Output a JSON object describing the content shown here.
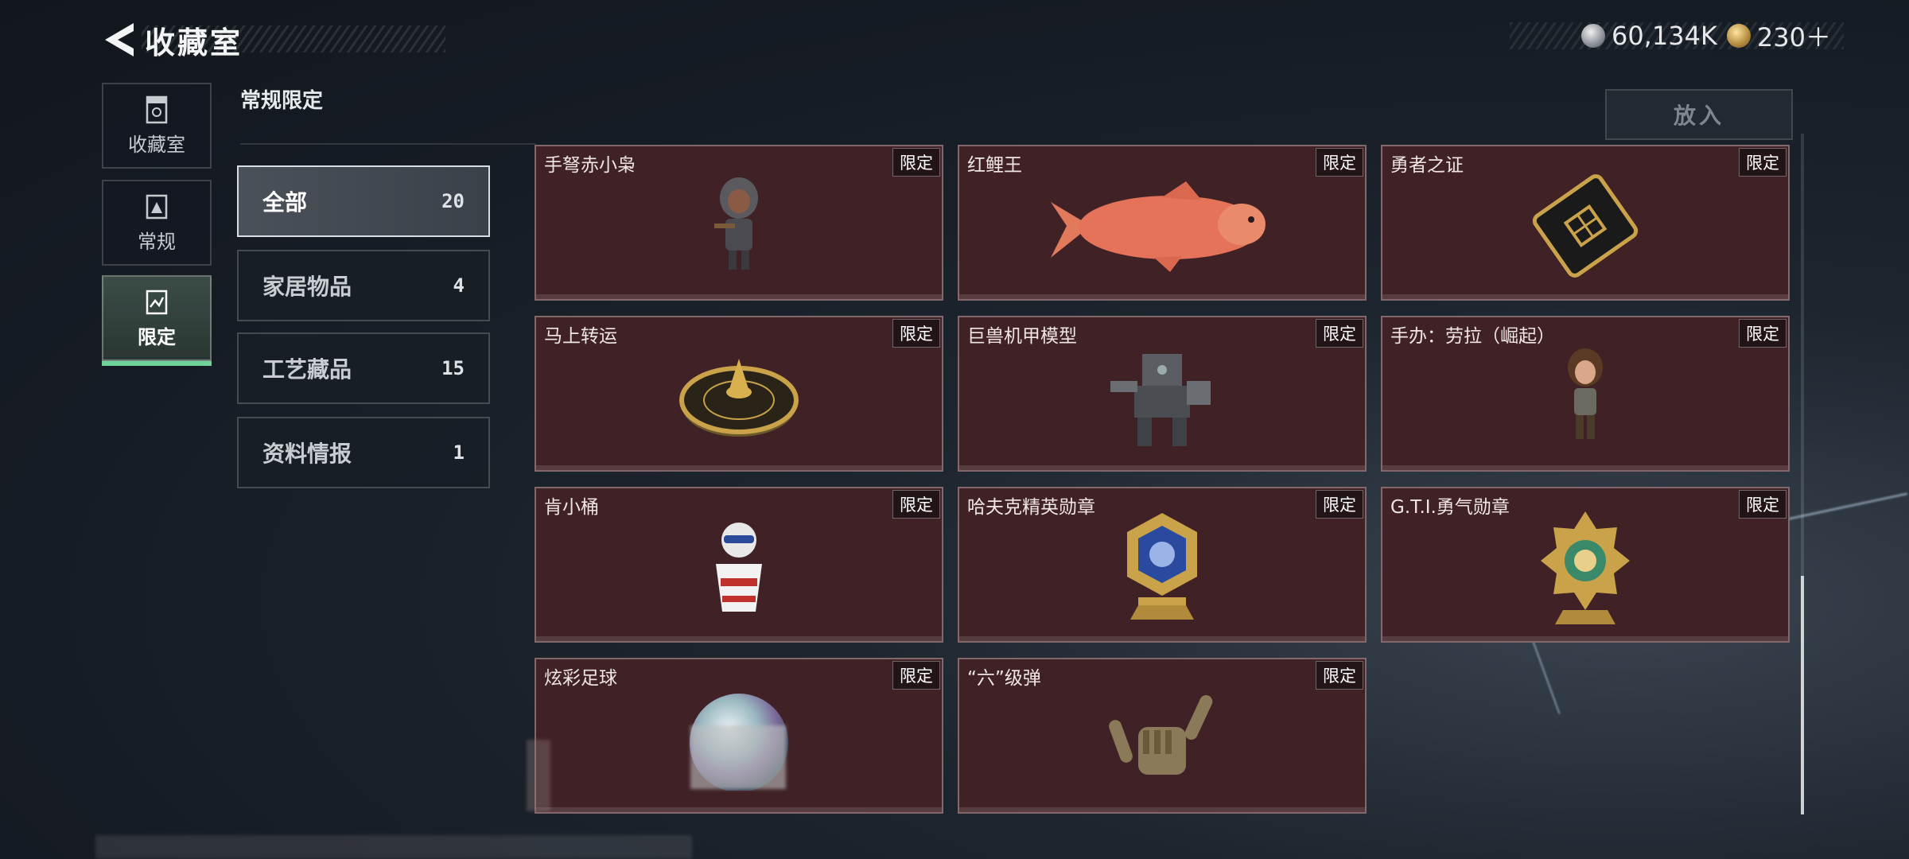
{
  "header": {
    "title": "收藏室",
    "back_icon": "back-arrow-icon"
  },
  "currency": {
    "silver_value": "60,134K",
    "gold_value": "230＋",
    "silver_icon": "silver-coin-icon",
    "gold_icon": "gold-coin-icon"
  },
  "side_tabs": [
    {
      "label": "收藏室",
      "icon": "collection-room-icon",
      "active": false
    },
    {
      "label": "常规",
      "icon": "regular-icon",
      "active": false
    },
    {
      "label": "限定",
      "icon": "limited-icon",
      "active": true
    }
  ],
  "section": {
    "title": "常规限定"
  },
  "categories": [
    {
      "name": "全部",
      "count": "20",
      "active": true
    },
    {
      "name": "家居物品",
      "count": "4",
      "active": false
    },
    {
      "name": "工艺藏品",
      "count": "15",
      "active": false
    },
    {
      "name": "资料情报",
      "count": "1",
      "active": false
    }
  ],
  "put_button": {
    "label": "放入"
  },
  "items": [
    {
      "name": "手弩赤小枭",
      "badge": "限定",
      "art": "figure-hooded-icon"
    },
    {
      "name": "红鲤王",
      "badge": "限定",
      "art": "red-carp-icon"
    },
    {
      "name": "勇者之证",
      "badge": "限定",
      "art": "brave-card-icon"
    },
    {
      "name": "马上转运",
      "badge": "限定",
      "art": "fortune-wheel-icon"
    },
    {
      "name": "巨兽机甲模型",
      "badge": "限定",
      "art": "mech-model-icon"
    },
    {
      "name": "手办：劳拉（崛起）",
      "badge": "限定",
      "art": "figure-lara-icon"
    },
    {
      "name": "肯小桶",
      "badge": "限定",
      "art": "bucket-figure-icon"
    },
    {
      "name": "哈夫克精英勋章",
      "badge": "限定",
      "art": "elite-medal-icon"
    },
    {
      "name": "G.T.I.勇气勋章",
      "badge": "限定",
      "art": "courage-medal-icon"
    },
    {
      "name": "炫彩足球",
      "badge": "限定",
      "art": "football-icon"
    },
    {
      "name": "“六”级弹",
      "badge": "限定",
      "art": "six-bullet-hand-icon"
    }
  ],
  "colors": {
    "card_bg": "#402226",
    "active_tab_indicator": "#6fd39a"
  }
}
